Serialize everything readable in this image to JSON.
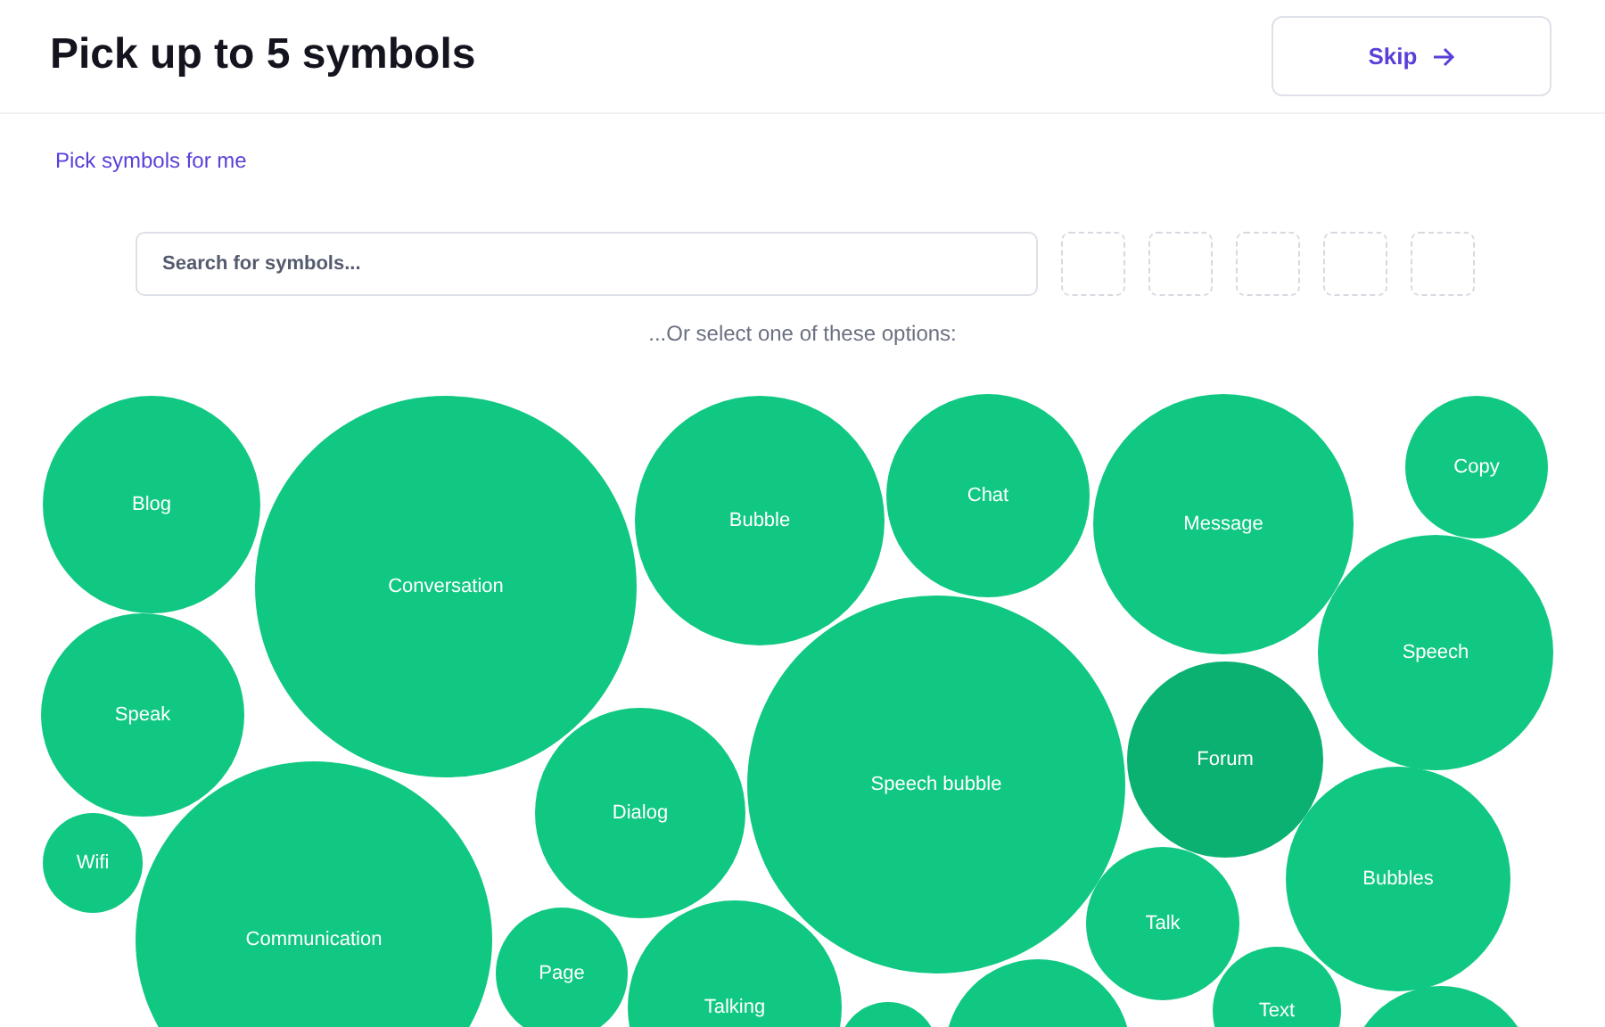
{
  "header": {
    "title": "Pick up to 5 symbols",
    "skip_button": {
      "label": "Skip"
    }
  },
  "auto_pick_link": "Pick symbols for me",
  "search": {
    "placeholder": "Search for symbols..."
  },
  "selected_slots": [
    {
      "filled": false
    },
    {
      "filled": false
    },
    {
      "filled": false
    },
    {
      "filled": false
    },
    {
      "filled": false
    }
  ],
  "options_hint": "...Or select one of these options:",
  "symbols": [
    {
      "label": "Blog",
      "hovered": false
    },
    {
      "label": "Conversation",
      "hovered": false
    },
    {
      "label": "Bubble",
      "hovered": false
    },
    {
      "label": "Chat",
      "hovered": false
    },
    {
      "label": "Message",
      "hovered": false
    },
    {
      "label": "Copy",
      "hovered": false
    },
    {
      "label": "Speak",
      "hovered": false
    },
    {
      "label": "Speech",
      "hovered": false
    },
    {
      "label": "Dialog",
      "hovered": false
    },
    {
      "label": "Speech bubble",
      "hovered": false
    },
    {
      "label": "Forum",
      "hovered": true
    },
    {
      "label": "Wifi",
      "hovered": false
    },
    {
      "label": "Communication",
      "hovered": false
    },
    {
      "label": "Bubbles",
      "hovered": false
    },
    {
      "label": "Talk",
      "hovered": false
    },
    {
      "label": "Page",
      "hovered": false
    },
    {
      "label": "Talking",
      "hovered": false
    },
    {
      "label": "Text",
      "hovered": false
    },
    {
      "hovered": false
    },
    {
      "hovered": false
    },
    {
      "hovered": false
    }
  ]
}
